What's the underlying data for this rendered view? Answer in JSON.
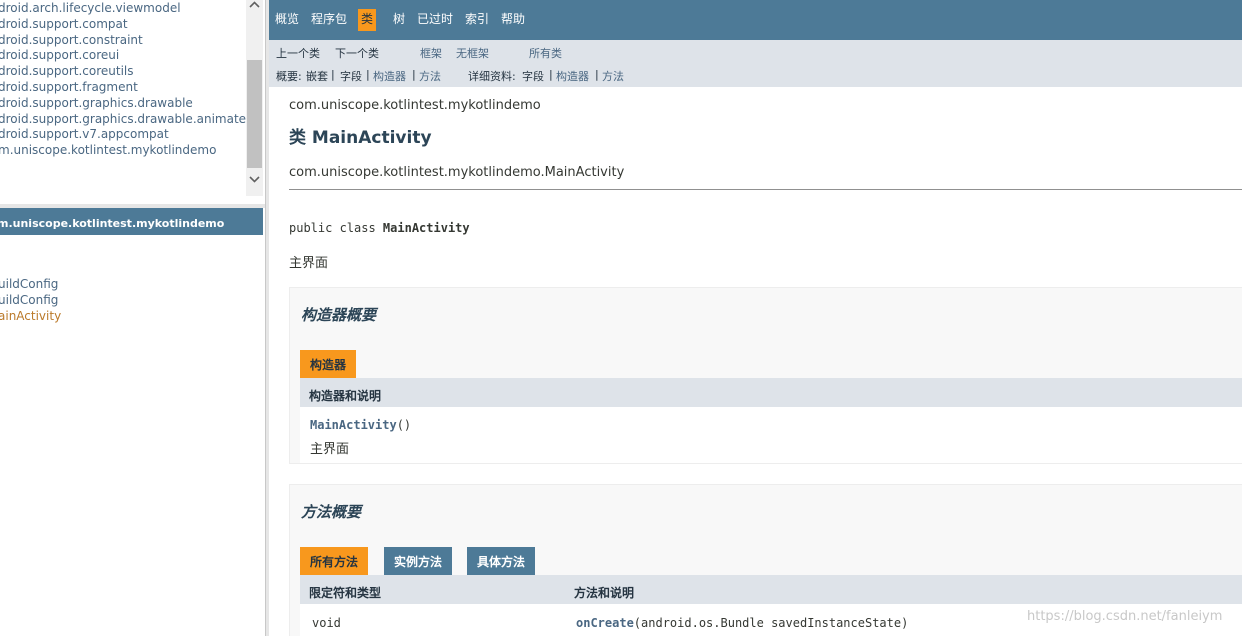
{
  "left_frame": {
    "packages": [
      "droid.arch.lifecycle.viewmodel",
      "droid.support.compat",
      "droid.support.constraint",
      "droid.support.coreui",
      "droid.support.coreutils",
      "droid.support.fragment",
      "droid.support.graphics.drawable",
      "droid.support.graphics.drawable.animated",
      "droid.support.v7.appcompat",
      "m.uniscope.kotlintest.mykotlindemo"
    ],
    "package_header": "m.uniscope.kotlintest.mykotlindemo",
    "classes": [
      "uildConfig",
      "uildConfig",
      "ainActivity"
    ],
    "scroll_up_icon": "chevron-up",
    "scroll_down_icon": "chevron-down"
  },
  "top_nav": {
    "items": [
      "概览",
      "程序包",
      "类",
      "树",
      "已过时",
      "索引",
      "帮助"
    ],
    "active": "类",
    "accent_color": "#f8981d",
    "bar_color": "#4d7a97"
  },
  "sub_nav": {
    "prev_class": "上一个类",
    "next_class": "下一个类",
    "frames": "框架",
    "no_frames": "无框架",
    "all_classes": "所有类",
    "summary_label": "概要:",
    "summary_nested": "嵌套",
    "summary_field": "字段",
    "summary_constructor": "构造器",
    "summary_method": "方法",
    "detail_label": "详细资料:",
    "detail_field": "字段",
    "detail_constructor": "构造器",
    "detail_method": "方法",
    "separator": "|"
  },
  "class_page": {
    "package_name": "com.uniscope.kotlintest.mykotlindemo",
    "title": "类 MainActivity",
    "inheritance": "com.uniscope.kotlintest.mykotlindemo.MainActivity",
    "signature_prefix": "public class ",
    "signature_name": "MainActivity",
    "description": "主界面"
  },
  "constructor_summary": {
    "heading": "构造器概要",
    "tab": "构造器",
    "column": "构造器和说明",
    "rows": [
      {
        "name": "MainActivity",
        "params": "()",
        "description": "主界面"
      }
    ]
  },
  "method_summary": {
    "heading": "方法概要",
    "tabs": [
      "所有方法",
      "实例方法",
      "具体方法"
    ],
    "active_tab": "所有方法",
    "columns": [
      "限定符和类型",
      "方法和说明"
    ],
    "rows": [
      {
        "modifier": "void",
        "name": "onCreate",
        "params": "(android.os.Bundle savedInstanceState)"
      }
    ]
  },
  "watermark": "https://blog.csdn.net/fanleiym"
}
